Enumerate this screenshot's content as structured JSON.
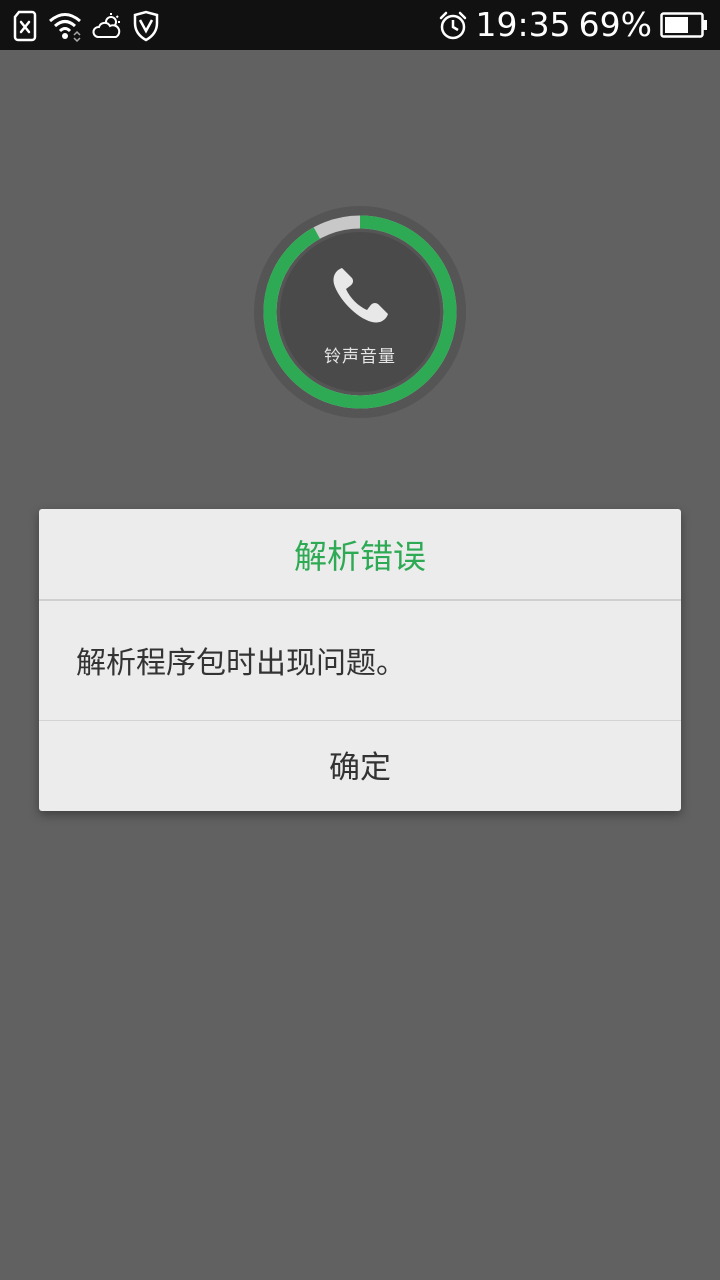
{
  "status_bar": {
    "time": "19:35",
    "battery_percent": "69%",
    "battery_level": 0.69,
    "icons": {
      "sim": "sim-error-icon",
      "wifi": "wifi-icon",
      "weather": "cloudy-weather-icon",
      "security": "shield-icon",
      "alarm": "alarm-clock-icon",
      "battery": "battery-icon"
    }
  },
  "volume_widget": {
    "label": "铃声音量",
    "icon": "phone-icon",
    "level": 0.92,
    "colors": {
      "filled": "#2eaa55",
      "empty": "#c8c8c8",
      "inner": "#4a4a4a",
      "outer": "#555555"
    }
  },
  "dialog": {
    "title": "解析错误",
    "message": "解析程序包时出现问题。",
    "confirm_label": "确定",
    "title_color": "#2eaa55"
  }
}
